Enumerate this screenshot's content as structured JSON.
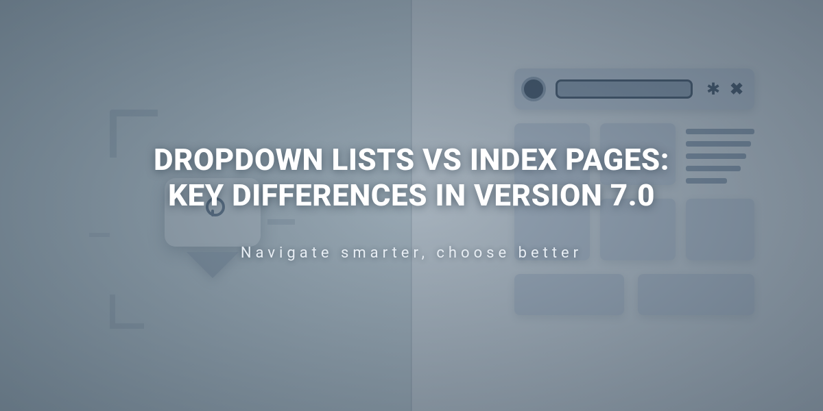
{
  "hero": {
    "title_line1": "DROPDOWN LISTS VS INDEX PAGES:",
    "title_line2": "KEY DIFFERENCES IN VERSION 7.0",
    "tagline": "Navigate smarter, choose better"
  },
  "icons": {
    "gear": "✱",
    "close": "✖"
  }
}
